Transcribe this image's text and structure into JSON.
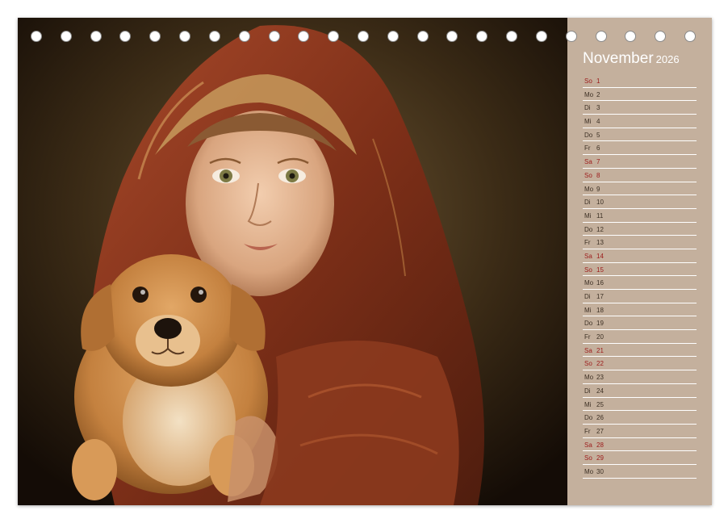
{
  "calendar": {
    "month": "November",
    "year": "2026",
    "days": [
      {
        "wd": "So",
        "d": "1",
        "weekend": true
      },
      {
        "wd": "Mo",
        "d": "2",
        "weekend": false
      },
      {
        "wd": "Di",
        "d": "3",
        "weekend": false
      },
      {
        "wd": "Mi",
        "d": "4",
        "weekend": false
      },
      {
        "wd": "Do",
        "d": "5",
        "weekend": false
      },
      {
        "wd": "Fr",
        "d": "6",
        "weekend": false
      },
      {
        "wd": "Sa",
        "d": "7",
        "weekend": true
      },
      {
        "wd": "So",
        "d": "8",
        "weekend": true
      },
      {
        "wd": "Mo",
        "d": "9",
        "weekend": false
      },
      {
        "wd": "Di",
        "d": "10",
        "weekend": false
      },
      {
        "wd": "Mi",
        "d": "11",
        "weekend": false
      },
      {
        "wd": "Do",
        "d": "12",
        "weekend": false
      },
      {
        "wd": "Fr",
        "d": "13",
        "weekend": false
      },
      {
        "wd": "Sa",
        "d": "14",
        "weekend": true
      },
      {
        "wd": "So",
        "d": "15",
        "weekend": true
      },
      {
        "wd": "Mo",
        "d": "16",
        "weekend": false
      },
      {
        "wd": "Di",
        "d": "17",
        "weekend": false
      },
      {
        "wd": "Mi",
        "d": "18",
        "weekend": false
      },
      {
        "wd": "Do",
        "d": "19",
        "weekend": false
      },
      {
        "wd": "Fr",
        "d": "20",
        "weekend": false
      },
      {
        "wd": "Sa",
        "d": "21",
        "weekend": true
      },
      {
        "wd": "So",
        "d": "22",
        "weekend": true
      },
      {
        "wd": "Mo",
        "d": "23",
        "weekend": false
      },
      {
        "wd": "Di",
        "d": "24",
        "weekend": false
      },
      {
        "wd": "Mi",
        "d": "25",
        "weekend": false
      },
      {
        "wd": "Do",
        "d": "26",
        "weekend": false
      },
      {
        "wd": "Fr",
        "d": "27",
        "weekend": false
      },
      {
        "wd": "Sa",
        "d": "28",
        "weekend": true
      },
      {
        "wd": "So",
        "d": "29",
        "weekend": true
      },
      {
        "wd": "Mo",
        "d": "30",
        "weekend": false
      }
    ]
  },
  "colors": {
    "panel": "#c4b09d",
    "weekend_text": "#9c1a1a",
    "weekday_text": "#3d3024",
    "title_text": "#ffffff"
  },
  "photo": {
    "icon": "portrait-girl-with-puppy-painting"
  },
  "binding": {
    "ring_count": 23
  }
}
